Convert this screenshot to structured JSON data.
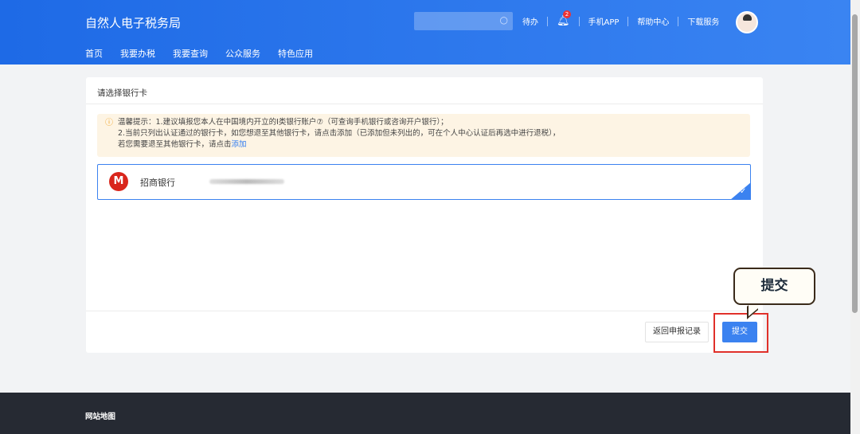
{
  "header": {
    "title": "自然人电子税务局",
    "search_placeholder": "",
    "links": [
      "待办",
      "手机APP",
      "帮助中心",
      "下载服务"
    ],
    "notification_count": "2"
  },
  "nav": [
    "首页",
    "我要办税",
    "我要查询",
    "公众服务",
    "特色应用"
  ],
  "card": {
    "title": "请选择银行卡",
    "alert": {
      "line1": "温馨提示：1.建议填报您本人在中国境内开立的Ⅰ类银行账户⑦（可查询手机银行或咨询开户银行）；",
      "line2": "2.当前只列出认证通过的银行卡，如您想退至其他银行卡，请点击添加（已添加但未列出的，可在个人中心认证后再选中进行退税），",
      "line3": "若您需要退至其他银行卡，请点击",
      "link": "添加"
    },
    "bank": {
      "name": "招商银行",
      "selected": true
    },
    "back_button": "返回申报记录",
    "submit_button": "提交"
  },
  "callout": "提交",
  "footer": {
    "sitemap": "网站地图"
  },
  "colors": {
    "primary": "#3b82f0",
    "highlight": "#e0302a"
  }
}
